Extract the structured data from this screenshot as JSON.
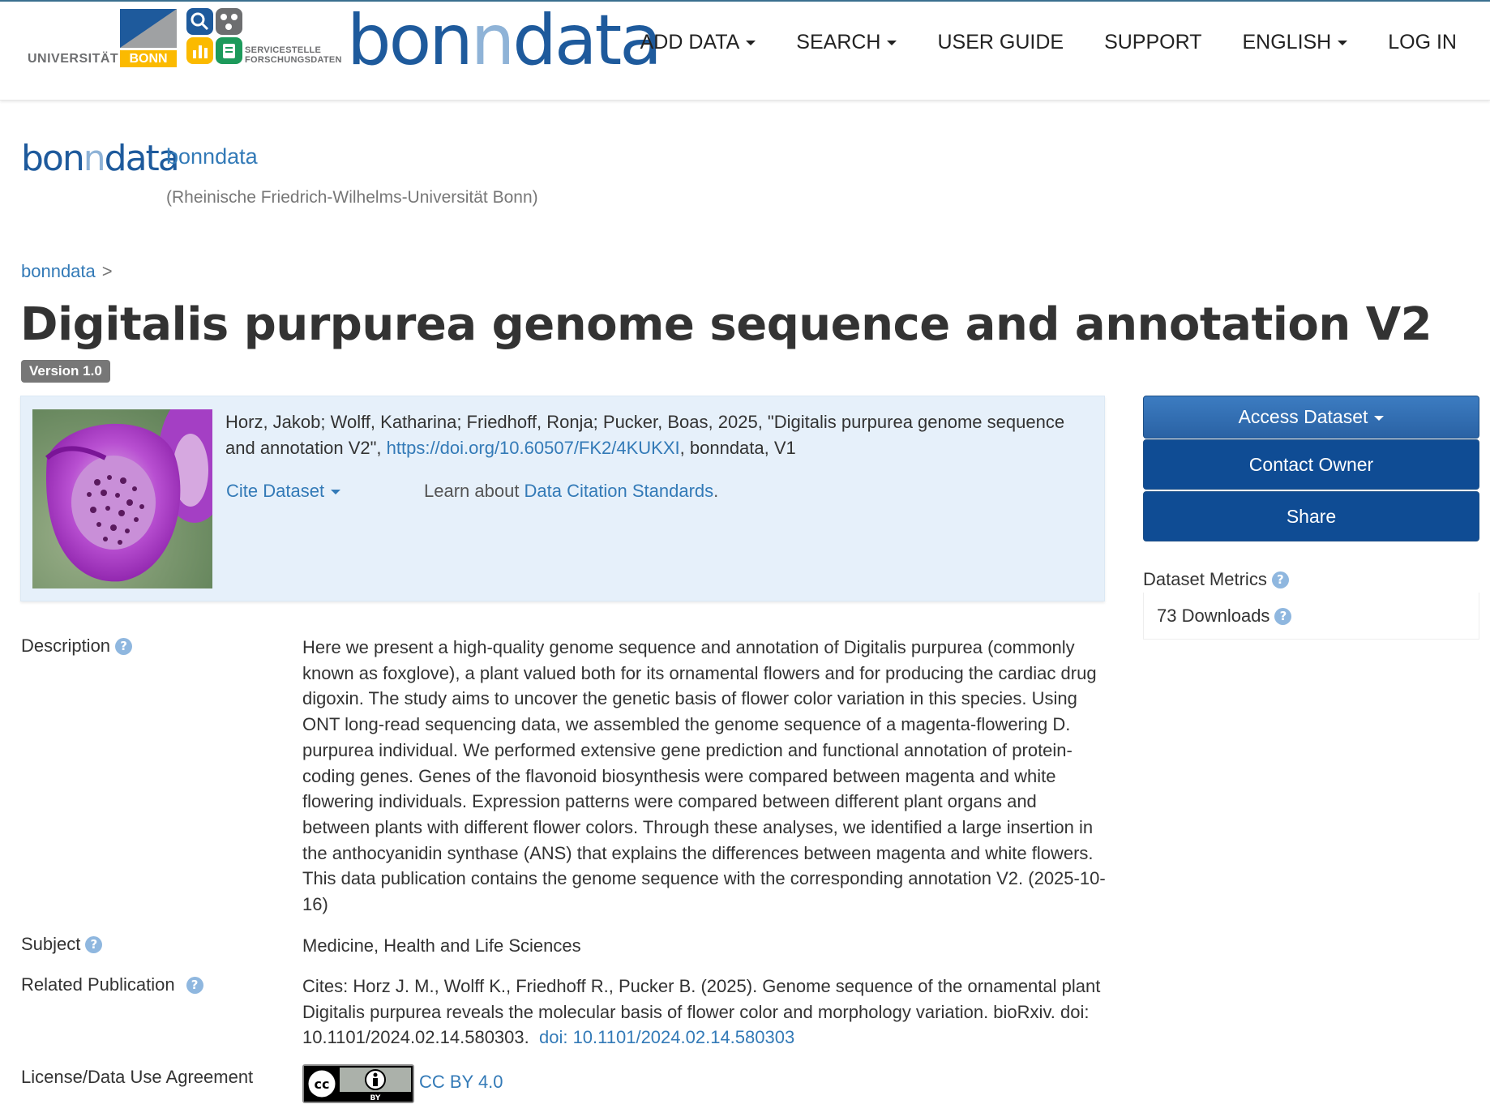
{
  "navbar": {
    "uni_logo_text": "UNIVERSITÄT",
    "uni_logo_bonn": "BONN",
    "sfd_line1": "SERVICESTELLE",
    "sfd_line2": "FORSCHUNGSDATEN",
    "brand_part1": "bon",
    "brand_part2": "n",
    "brand_part3": "data",
    "items": [
      {
        "label": "ADD DATA",
        "dropdown": true
      },
      {
        "label": "SEARCH",
        "dropdown": true
      },
      {
        "label": "USER GUIDE",
        "dropdown": false
      },
      {
        "label": "SUPPORT",
        "dropdown": false
      },
      {
        "label": "ENGLISH",
        "dropdown": true
      },
      {
        "label": "LOG IN",
        "dropdown": false
      }
    ]
  },
  "dataverse": {
    "logo_part1": "bon",
    "logo_part2": "n",
    "logo_part3": "data",
    "name": "bonndata",
    "affiliation": "(Rheinische Friedrich-Wilhelms-Universität Bonn)"
  },
  "breadcrumb": {
    "root": "bonndata",
    "separator": ">"
  },
  "dataset": {
    "title": "Digitalis purpurea genome sequence and annotation V2",
    "version": "Version 1.0",
    "citation_prefix": "Horz, Jakob; Wolff, Katharina; Friedhoff, Ronja; Pucker, Boas, 2025, \"Digitalis purpurea genome sequence and annotation V2\", ",
    "citation_doi": "https://doi.org/10.60507/FK2/4KUKXI",
    "citation_suffix": ", bonndata, V1",
    "cite_button": "Cite Dataset",
    "learn_prefix": "Learn about ",
    "learn_link": "Data Citation Standards",
    "learn_suffix": "."
  },
  "actions": {
    "access": "Access Dataset",
    "contact": "Contact Owner",
    "share": "Share"
  },
  "metrics": {
    "label": "Dataset Metrics",
    "downloads": "73 Downloads"
  },
  "metadata": {
    "description_label": "Description",
    "description": "Here we present a high-quality genome sequence and annotation of Digitalis purpurea (commonly known as foxglove), a plant valued both for its ornamental flowers and for producing the cardiac drug digoxin. The study aims to uncover the genetic basis of flower color variation in this species. Using ONT long-read sequencing data, we assembled the genome sequence of a magenta-flowering D. purpurea individual. We performed extensive gene prediction and functional annotation of protein-coding genes. Genes of the flavonoid biosynthesis were compared between magenta and white flowering individuals. Expression patterns were compared between different plant organs and between plants with different flower colors. Through these analyses, we identified a large insertion in the anthocyanidin synthase (ANS) that explains the differences between magenta and white flowers. This data publication contains the genome sequence with the corresponding annotation V2. (2025-10-16)",
    "subject_label": "Subject",
    "subject": "Medicine, Health and Life Sciences",
    "related_label": "Related Publication",
    "related_text": "Cites: Horz J. M., Wolff K., Friedhoff R., Pucker B. (2025). Genome sequence of the ornamental plant Digitalis purpurea reveals the molecular basis of flower color and morphology variation. bioRxiv. doi: 10.1101/2024.02.14.580303.",
    "related_link": "doi: 10.1101/2024.02.14.580303",
    "license_label": "License/Data Use Agreement",
    "license_link": "CC BY 4.0",
    "cc_badge_text": "BY"
  },
  "colors": {
    "brand_blue": "#1e5a9c",
    "link_blue": "#337ab7",
    "button_blue": "#0f4c94",
    "citation_bg": "#e6f0fa"
  }
}
